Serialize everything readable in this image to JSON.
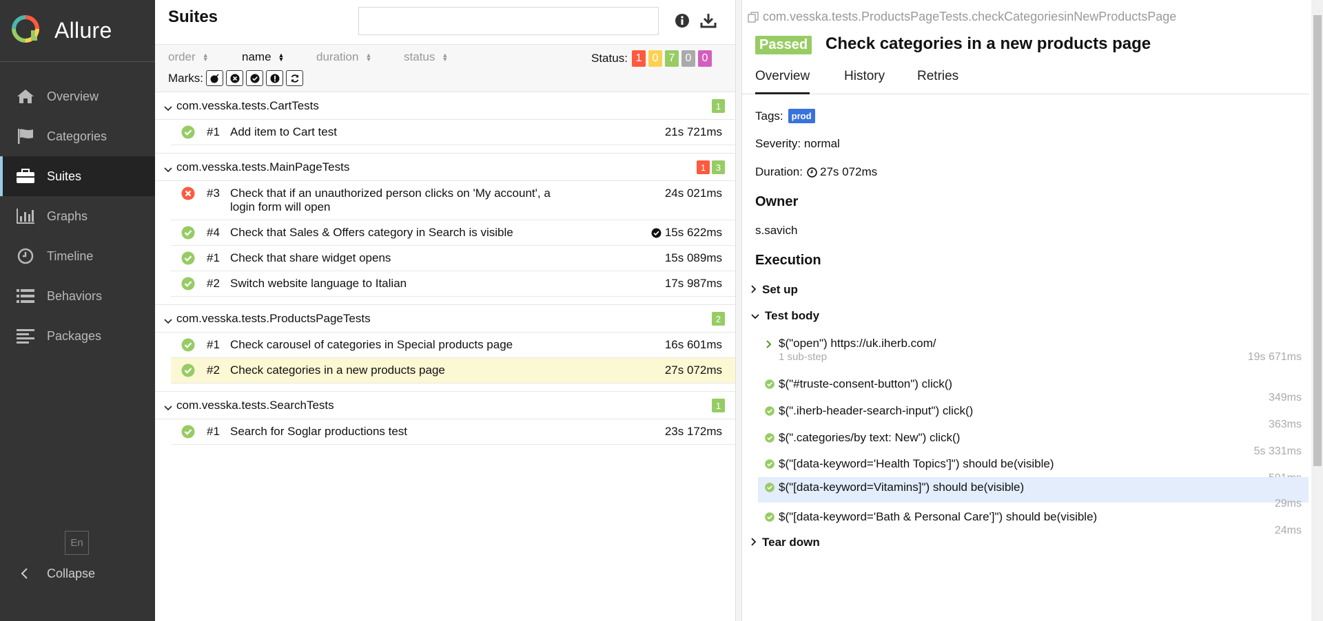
{
  "sidebar": {
    "brand": "Allure",
    "items": [
      {
        "label": "Overview",
        "icon": "home-icon"
      },
      {
        "label": "Categories",
        "icon": "flag-icon"
      },
      {
        "label": "Suites",
        "icon": "briefcase-icon"
      },
      {
        "label": "Graphs",
        "icon": "bar-chart-icon"
      },
      {
        "label": "Timeline",
        "icon": "clock-icon"
      },
      {
        "label": "Behaviors",
        "icon": "list-icon"
      },
      {
        "label": "Packages",
        "icon": "align-left-icon"
      }
    ],
    "language": "En",
    "collapse_label": "Collapse"
  },
  "suites": {
    "title": "Suites",
    "search_placeholder": "",
    "sort": {
      "order": "order",
      "name": "name",
      "duration": "duration",
      "status": "status"
    },
    "status_label": "Status:",
    "status_counts": {
      "failed": "1",
      "broken": "0",
      "passed": "7",
      "skipped": "0",
      "unknown": "0"
    },
    "marks_label": "Marks:",
    "groups": [
      {
        "name": "com.vesska.tests.CartTests",
        "counts": [
          {
            "type": "passed",
            "value": "1"
          }
        ],
        "tests": [
          {
            "status": "passed",
            "num": "#1",
            "name": "Add item to Cart test",
            "duration": "21s 721ms"
          }
        ]
      },
      {
        "name": "com.vesska.tests.MainPageTests",
        "counts": [
          {
            "type": "failed",
            "value": "1"
          },
          {
            "type": "passed",
            "value": "3"
          }
        ],
        "tests": [
          {
            "status": "failed",
            "num": "#3",
            "name": "Check that if an unauthorized person clicks on 'My account', a login form will open",
            "duration": "24s 021ms"
          },
          {
            "status": "passed",
            "num": "#4",
            "name": "Check that Sales & Offers category in Search is visible",
            "duration": "15s 622ms",
            "flag": true
          },
          {
            "status": "passed",
            "num": "#1",
            "name": "Check that share widget opens",
            "duration": "15s 089ms"
          },
          {
            "status": "passed",
            "num": "#2",
            "name": "Switch website language to Italian",
            "duration": "17s 987ms"
          }
        ]
      },
      {
        "name": "com.vesska.tests.ProductsPageTests",
        "counts": [
          {
            "type": "passed",
            "value": "2"
          }
        ],
        "tests": [
          {
            "status": "passed",
            "num": "#1",
            "name": "Check carousel of categories in Special products page",
            "duration": "16s 601ms"
          },
          {
            "status": "passed",
            "num": "#2",
            "name": "Check categories in a new products page",
            "duration": "27s 072ms",
            "selected": true
          }
        ]
      },
      {
        "name": "com.vesska.tests.SearchTests",
        "counts": [
          {
            "type": "passed",
            "value": "1"
          }
        ],
        "tests": [
          {
            "status": "passed",
            "num": "#1",
            "name": "Search for Soglar productions test",
            "duration": "23s 172ms"
          }
        ]
      }
    ]
  },
  "detail": {
    "path": "com.vesska.tests.ProductsPageTests.checkCategoriesinNewProductsPage",
    "status": "Passed",
    "title": "Check categories in a new products page",
    "tabs": [
      "Overview",
      "History",
      "Retries"
    ],
    "tags_label": "Tags:",
    "tag": "prod",
    "severity": "Severity: normal",
    "duration_label": "Duration:",
    "duration": "27s 072ms",
    "owner_heading": "Owner",
    "owner": "s.savich",
    "execution_heading": "Execution",
    "setup": "Set up",
    "test_body": "Test body",
    "teardown": "Tear down",
    "steps": [
      {
        "text": "$(\"open\") https://uk.iherb.com/",
        "sub": "1 sub-step",
        "time": "19s 671ms",
        "expandable": true
      },
      {
        "text": "$(\"#truste-consent-button\") click()",
        "time": "349ms"
      },
      {
        "text": "$(\".iherb-header-search-input\") click()",
        "time": "363ms"
      },
      {
        "text": "$(\".categories/by text: New\") click()",
        "time": "5s 331ms"
      },
      {
        "text": "$(\"[data-keyword='Health Topics']\") should be(visible)",
        "time": "591ms"
      },
      {
        "text": "$(\"[data-keyword=Vitamins]\") should be(visible)",
        "time": "29ms"
      },
      {
        "text": "$(\"[data-keyword='Bath & Personal Care']\") should be(visible)",
        "time": "24ms"
      }
    ]
  },
  "colors": {
    "failed": "#fd5a3e",
    "broken": "#ffd050",
    "passed": "#97cc64",
    "skipped": "#aaaaaa",
    "unknown": "#d35ebe",
    "tag": "#3872dc"
  }
}
